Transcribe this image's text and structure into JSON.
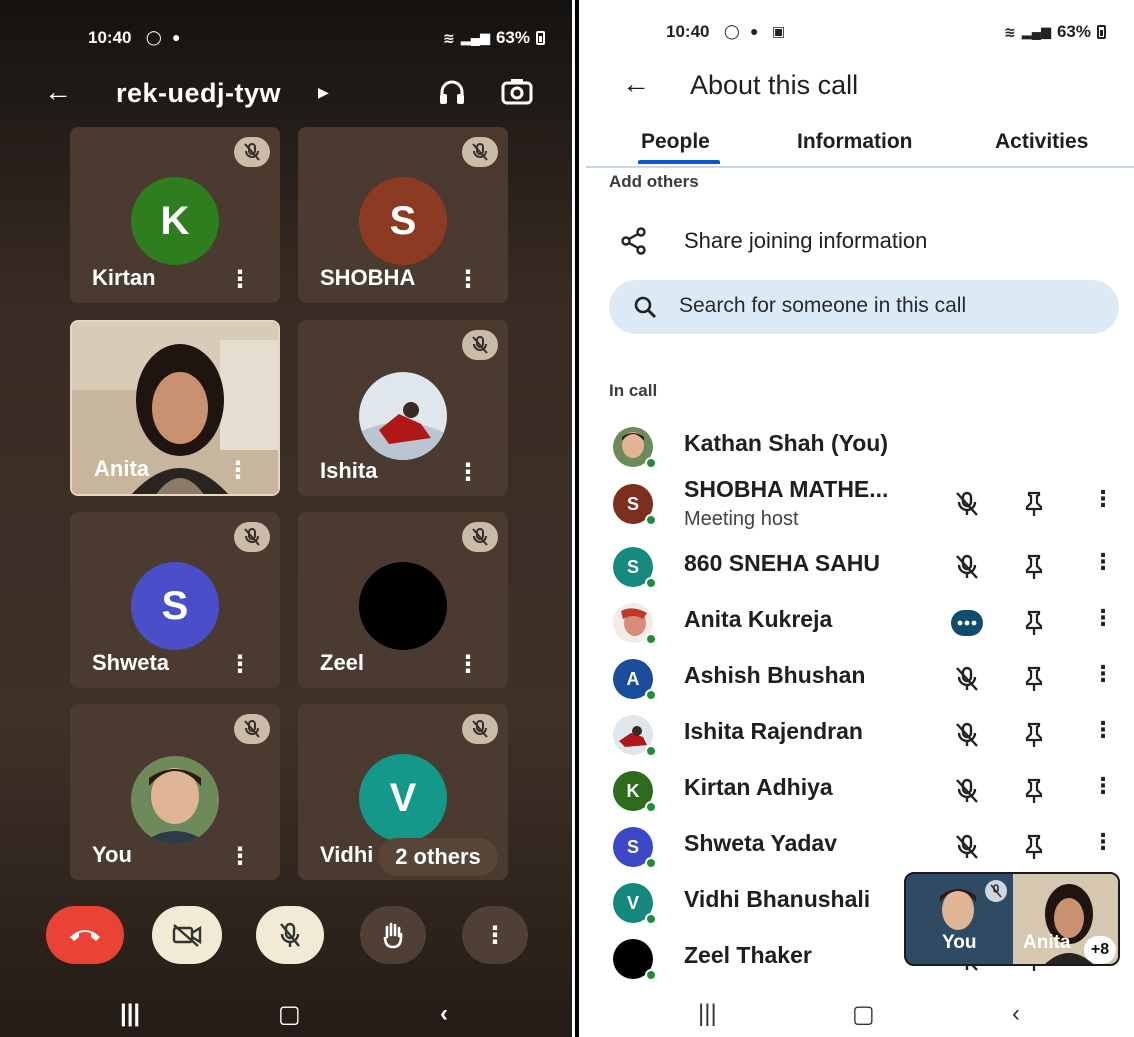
{
  "left_phone": {
    "status_bar": {
      "time": "10:40",
      "battery": "63%"
    },
    "header": {
      "meeting_code": "rek-uedj-tyw"
    },
    "tiles": [
      {
        "name": "Kirtan",
        "initial": "K",
        "color": "#2e7d1e",
        "muted": true
      },
      {
        "name": "SHOBHA",
        "initial": "S",
        "color": "#8c3b22",
        "muted": true
      },
      {
        "name": "Anita",
        "initial": "",
        "color": "",
        "muted": false
      },
      {
        "name": "Ishita",
        "initial": "",
        "color": "",
        "muted": true
      },
      {
        "name": "Shweta",
        "initial": "S",
        "color": "#4a4ec9",
        "muted": true
      },
      {
        "name": "Zeel",
        "initial": "",
        "color": "#000000",
        "muted": true
      },
      {
        "name": "You",
        "initial": "",
        "color": "",
        "muted": true
      },
      {
        "name": "Vidhi",
        "initial": "V",
        "color": "#14988a",
        "muted": true
      }
    ],
    "others_pill": "2 others",
    "controls": [
      "end-call",
      "camera-off",
      "mic-off",
      "raise-hand",
      "more"
    ]
  },
  "right_phone": {
    "status_bar": {
      "time": "10:40",
      "battery": "63%"
    },
    "header": {
      "title": "About this call"
    },
    "tabs": [
      "People",
      "Information",
      "Activities"
    ],
    "active_tab": "People",
    "add_others_label": "Add others",
    "share_label": "Share joining information",
    "search_placeholder": "Search for someone in this call",
    "in_call_label": "In call",
    "people": [
      {
        "name": "Kathan Shah (You)",
        "sub": "",
        "initial": "",
        "color": "",
        "icon": "none"
      },
      {
        "name": "SHOBHA MATHE...",
        "sub": "Meeting host",
        "initial": "S",
        "color": "#7b2f1c",
        "icon": "mic-off"
      },
      {
        "name": "860 SNEHA SAHU",
        "sub": "",
        "initial": "S",
        "color": "#168a7c",
        "icon": "mic-off"
      },
      {
        "name": "Anita Kukreja",
        "sub": "",
        "initial": "",
        "color": "",
        "icon": "speaking"
      },
      {
        "name": "Ashish Bhushan",
        "sub": "",
        "initial": "A",
        "color": "#1a4d9a",
        "icon": "mic-off"
      },
      {
        "name": "Ishita Rajendran",
        "sub": "",
        "initial": "",
        "color": "",
        "icon": "mic-off"
      },
      {
        "name": "Kirtan Adhiya",
        "sub": "",
        "initial": "K",
        "color": "#2e6b1c",
        "icon": "mic-off"
      },
      {
        "name": "Shweta Yadav",
        "sub": "",
        "initial": "S",
        "color": "#3c48c8",
        "icon": "mic-off"
      },
      {
        "name": "Vidhi Bhanushali",
        "sub": "",
        "initial": "V",
        "color": "#14887c",
        "icon": "mic-off"
      },
      {
        "name": "Zeel Thaker",
        "sub": "",
        "initial": "",
        "color": "#000000",
        "icon": "mic-off"
      }
    ],
    "pip": {
      "you_label": "You",
      "anita_label": "Anita",
      "count": "+8"
    }
  }
}
